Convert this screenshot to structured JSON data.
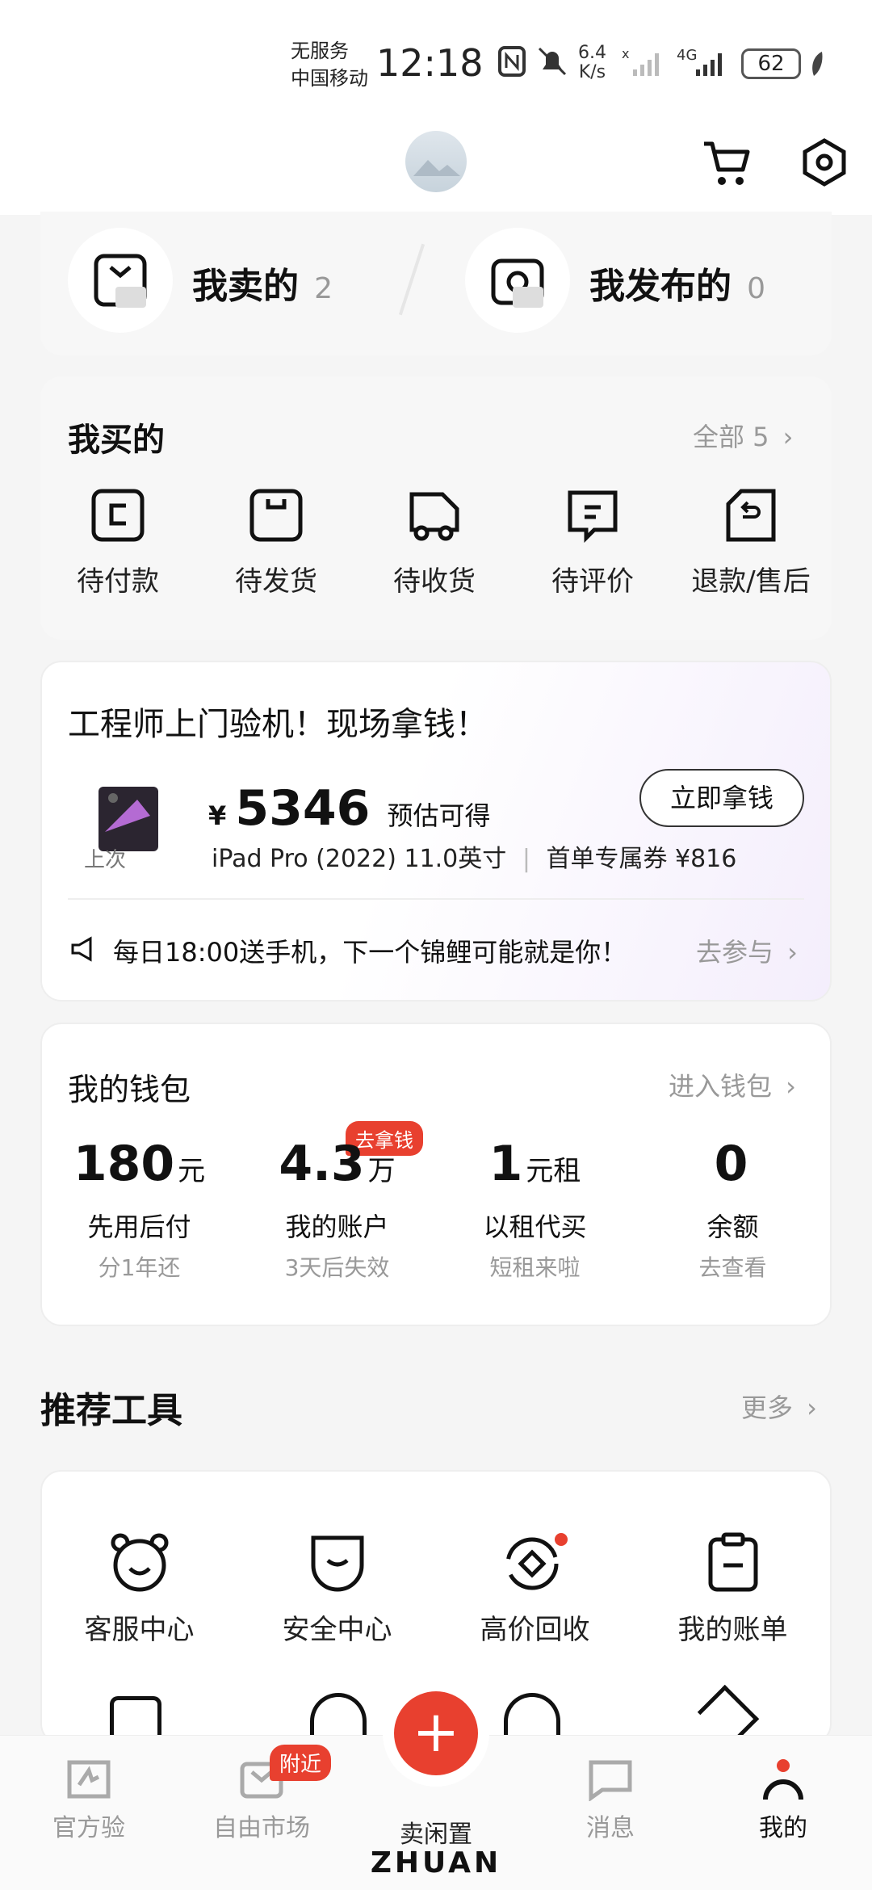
{
  "status_bar": {
    "carrier_line1": "无服务",
    "carrier_line2": "中国移动",
    "time": "12:18",
    "speed_value": "6.4",
    "speed_unit": "K/s",
    "network": "4G",
    "battery": "62"
  },
  "summary": {
    "sold_label": "我卖的",
    "sold_count": "2",
    "published_label": "我发布的",
    "published_count": "0"
  },
  "bought": {
    "title": "我买的",
    "all_label": "全部 5",
    "items": [
      "待付款",
      "待发货",
      "待收货",
      "待评价",
      "退款/售后"
    ]
  },
  "recycle": {
    "title": "工程师上门验机！现场拿钱！",
    "currency": "¥",
    "price": "5346",
    "price_note": "预估可得",
    "last_tag": "上次",
    "product": "iPad Pro (2022) 11.0英寸",
    "coupon": "首单专属券 ¥816",
    "button": "立即拿钱",
    "notice": "每日18:00送手机，下一个锦鲤可能就是你！",
    "join": "去参与"
  },
  "wallet": {
    "title": "我的钱包",
    "enter": "进入钱包",
    "badge": "去拿钱",
    "items": [
      {
        "value": "180",
        "unit": "元",
        "label": "先用后付",
        "sub": "分1年还"
      },
      {
        "value": "4.3",
        "unit": "万",
        "label": "我的账户",
        "sub": "3天后失效"
      },
      {
        "value": "1",
        "unit": "元租",
        "label": "以租代买",
        "sub": "短租来啦"
      },
      {
        "value": "0",
        "unit": "",
        "label": "余额",
        "sub": "去查看"
      }
    ]
  },
  "tools": {
    "title": "推荐工具",
    "more": "更多",
    "items": [
      "客服中心",
      "安全中心",
      "高价回收",
      "我的账单"
    ]
  },
  "nav": {
    "items": [
      "官方验",
      "自由市场",
      "卖闲置",
      "消息",
      "我的"
    ],
    "nearby_badge": "附近",
    "brand": "ZHUAN"
  },
  "colors": {
    "accent": "#e8402f",
    "text": "#111111",
    "muted": "#999999"
  }
}
